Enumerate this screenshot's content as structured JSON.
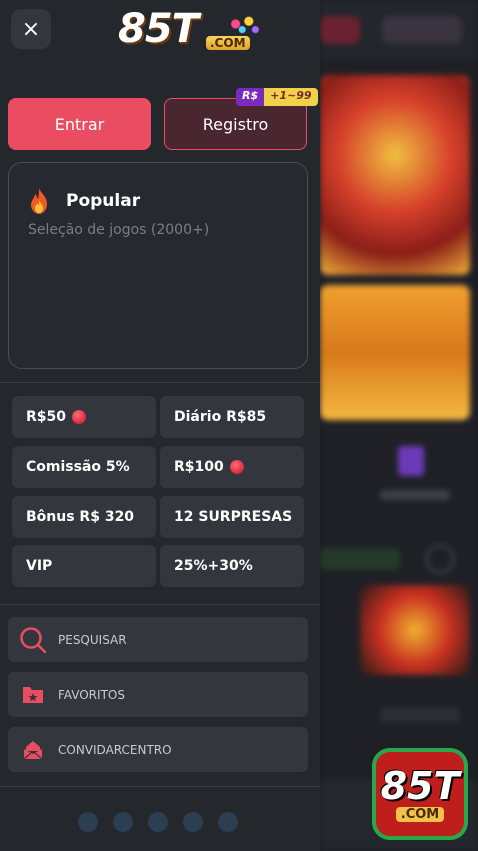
{
  "header": {
    "close_label": "×",
    "logo_text": "85T",
    "logo_com": ".COM"
  },
  "auth": {
    "login_label": "Entrar",
    "register_label": "Registro",
    "register_badge_currency": "R$",
    "register_badge_amount": "+1~99"
  },
  "popular": {
    "title": "Popular",
    "subtitle": "Seleção de jogos (2000+)",
    "icon": "fire-icon"
  },
  "promos": [
    {
      "label": "R$50",
      "has_dot": true
    },
    {
      "label": "Diário R$85",
      "has_dot": false
    },
    {
      "label": "Comissão 5%",
      "has_dot": false
    },
    {
      "label": "R$100",
      "has_dot": true
    },
    {
      "label": "Bônus R$ 320",
      "has_dot": false
    },
    {
      "label": "12 SURPRESAS",
      "has_dot": false
    },
    {
      "label": "VIP",
      "has_dot": false
    },
    {
      "label": "25%+30%",
      "has_dot": false
    }
  ],
  "menu": [
    {
      "label": "PESQUISAR",
      "icon": "search-icon"
    },
    {
      "label": "FAVORITOS",
      "icon": "folder-star-icon"
    },
    {
      "label": "CONVIDARCENTRO",
      "icon": "invite-icon"
    }
  ],
  "floating_logo": {
    "text": "85T",
    "com": ".COM"
  },
  "colors": {
    "accent": "#ea4c62",
    "drawer_bg": "#24272c",
    "item_bg": "#33363c"
  }
}
